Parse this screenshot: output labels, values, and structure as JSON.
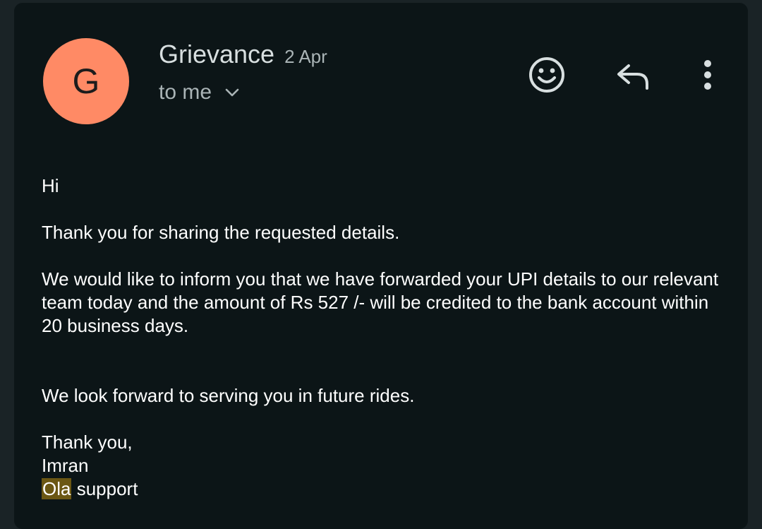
{
  "header": {
    "avatar_letter": "G",
    "sender_name": "Grievance",
    "date": "2 Apr",
    "recipient": "to me"
  },
  "actions": {
    "icons": [
      "emoji-icon",
      "reply-icon",
      "more-vertical-icon"
    ]
  },
  "message": {
    "greeting": "Hi",
    "thanks": "Thank you for sharing the requested details.",
    "info": "We would like to inform you that we have forwarded your UPI details to our relevant team today and the amount of Rs  527 /- will be credited to the bank account within 20 business days.",
    "forward": "We look forward to serving you in future rides.",
    "closing": "Thank you,",
    "signer": "Imran",
    "team_highlight": "Ola",
    "team_rest": " support"
  },
  "colors": {
    "background": "#0c1517",
    "avatar": "#ff8a65",
    "highlight": "#6b5713",
    "secondary_text": "#aab4b6"
  }
}
